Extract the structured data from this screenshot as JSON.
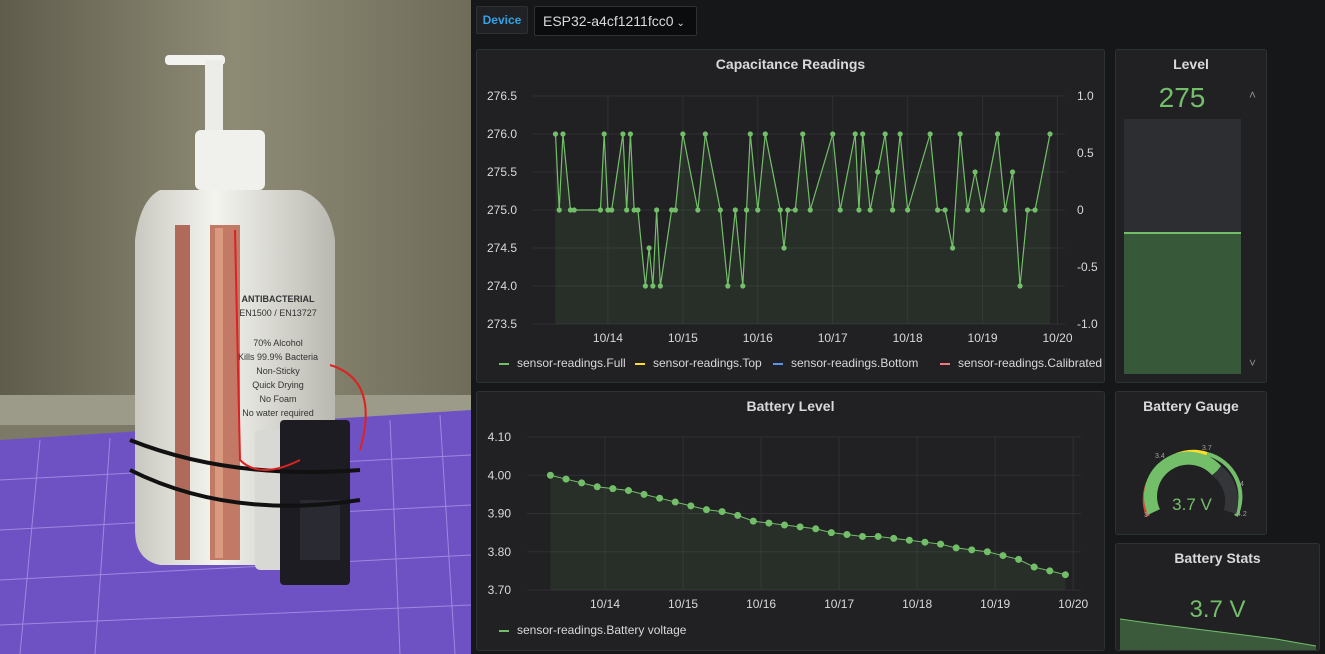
{
  "photo": {
    "alt": "Hand sanitizer bottle with capacitive sensor strips and ESP32 board on cutting mat",
    "label_lines": [
      "ANTIBACTERIAL",
      "EN1500 / EN13727",
      "70% Alcohol",
      "Kills 99.9% Bacteria",
      "Non-Sticky",
      "Quick Drying",
      "No Foam",
      "No water required"
    ]
  },
  "toolbar": {
    "variable_label": "Device",
    "device_value": "ESP32-a4cf1211fcc0",
    "dropdown_icon": "chevron-down-icon"
  },
  "colors": {
    "series_green": "#73bf69",
    "top_yellow": "#fade2a",
    "bottom_blue": "#5794f2",
    "calibrated_orange": "#ff7383",
    "gauge_red": "#d44a3a"
  },
  "capacitance": {
    "title": "Capacitance Readings",
    "legend": [
      "sensor-readings.Full",
      "sensor-readings.Top",
      "sensor-readings.Bottom",
      "sensor-readings.Calibrated"
    ],
    "left_ticks": [
      "276.5",
      "276.0",
      "275.5",
      "275.0",
      "274.5",
      "274.0",
      "273.5"
    ],
    "right_ticks": [
      "1.0",
      "0.5",
      "0",
      "-0.5",
      "-1.0"
    ],
    "x_ticks": [
      "10/14",
      "10/15",
      "10/16",
      "10/17",
      "10/18",
      "10/19",
      "10/20"
    ]
  },
  "level": {
    "title": "Level",
    "value": "275",
    "fill_fraction": 0.55,
    "up_icon": "chevron-up-icon",
    "down_icon": "chevron-down-icon"
  },
  "battery_level": {
    "title": "Battery Level",
    "legend": "sensor-readings.Battery voltage",
    "y_ticks": [
      "4.10",
      "4.00",
      "3.90",
      "3.80",
      "3.70"
    ],
    "x_ticks": [
      "10/14",
      "10/15",
      "10/16",
      "10/17",
      "10/18",
      "10/19",
      "10/20"
    ]
  },
  "gauge": {
    "title": "Battery Gauge",
    "value": "3.7 V",
    "thresholds": [
      "3",
      "3.4",
      "3.7",
      "4",
      "4.2"
    ]
  },
  "stats": {
    "title": "Battery Stats",
    "value": "3.7 V"
  },
  "chart_data": [
    {
      "type": "line",
      "title": "Capacitance Readings",
      "ylim": [
        273.5,
        276.5
      ],
      "y2lim": [
        -1.0,
        1.0
      ],
      "x": [
        13.3,
        13.35,
        13.4,
        13.5,
        13.55,
        13.9,
        13.95,
        14.0,
        14.05,
        14.2,
        14.25,
        14.3,
        14.35,
        14.4,
        14.5,
        14.55,
        14.6,
        14.65,
        14.7,
        14.85,
        14.9,
        15.0,
        15.2,
        15.3,
        15.5,
        15.6,
        15.7,
        15.8,
        15.85,
        15.9,
        16.0,
        16.1,
        16.3,
        16.35,
        16.4,
        16.5,
        16.6,
        16.7,
        17.0,
        17.1,
        17.3,
        17.35,
        17.4,
        17.5,
        17.6,
        17.7,
        17.8,
        17.9,
        18.0,
        18.3,
        18.4,
        18.5,
        18.6,
        18.7,
        18.8,
        18.9,
        19.0,
        19.2,
        19.3,
        19.4,
        19.5,
        19.6,
        19.7,
        19.9
      ],
      "series": [
        {
          "name": "sensor-readings.Full",
          "values": [
            276.0,
            275.0,
            276.0,
            275.0,
            275.0,
            275.0,
            276.0,
            275.0,
            275.0,
            276.0,
            275.0,
            276.0,
            275.0,
            275.0,
            274.0,
            274.5,
            274.0,
            275.0,
            274.0,
            275.0,
            275.0,
            276.0,
            275.0,
            276.0,
            275.0,
            274.0,
            275.0,
            274.0,
            275.0,
            276.0,
            275.0,
            276.0,
            275.0,
            274.5,
            275.0,
            275.0,
            276.0,
            275.0,
            276.0,
            275.0,
            276.0,
            275.0,
            276.0,
            275.0,
            275.5,
            276.0,
            275.0,
            276.0,
            275.0,
            276.0,
            275.0,
            275.0,
            274.5,
            276.0,
            275.0,
            275.5,
            275.0,
            276.0,
            275.0,
            275.5,
            274.0,
            275.0,
            275.0,
            276.0
          ]
        }
      ],
      "xlabel": "",
      "ylabel": ""
    },
    {
      "type": "line",
      "title": "Battery Level",
      "ylim": [
        3.7,
        4.1
      ],
      "x": [
        13.3,
        13.5,
        13.7,
        13.9,
        14.1,
        14.3,
        14.5,
        14.7,
        14.9,
        15.1,
        15.3,
        15.5,
        15.7,
        15.9,
        16.1,
        16.3,
        16.5,
        16.7,
        16.9,
        17.1,
        17.3,
        17.5,
        17.7,
        17.9,
        18.1,
        18.3,
        18.5,
        18.7,
        18.9,
        19.1,
        19.3,
        19.5,
        19.7,
        19.9
      ],
      "series": [
        {
          "name": "sensor-readings.Battery voltage",
          "values": [
            4.0,
            3.99,
            3.98,
            3.97,
            3.965,
            3.96,
            3.95,
            3.94,
            3.93,
            3.92,
            3.91,
            3.905,
            3.895,
            3.88,
            3.875,
            3.87,
            3.865,
            3.86,
            3.85,
            3.845,
            3.84,
            3.84,
            3.835,
            3.83,
            3.825,
            3.82,
            3.81,
            3.805,
            3.8,
            3.79,
            3.78,
            3.76,
            3.75,
            3.74
          ]
        }
      ],
      "xlabel": "",
      "ylabel": ""
    }
  ]
}
